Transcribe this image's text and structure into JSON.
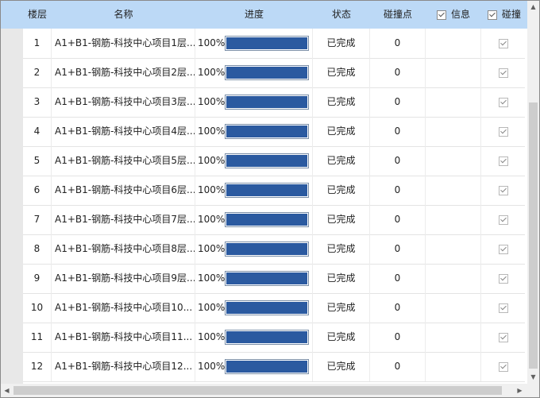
{
  "columns": {
    "floor": "楼层",
    "name": "名称",
    "progress": "进度",
    "status": "状态",
    "collision_points": "碰撞点",
    "info": "信息",
    "collision": "碰撞"
  },
  "header_checkboxes": {
    "info_checked": true,
    "collision_checked": true
  },
  "rows": [
    {
      "index": "1",
      "name": "A1+B1-钢筋-科技中心项目1层...",
      "progress_label": "100%",
      "progress": 1.0,
      "status": "已完成",
      "count": "0",
      "collision_checked": true
    },
    {
      "index": "2",
      "name": "A1+B1-钢筋-科技中心项目2层...",
      "progress_label": "100%",
      "progress": 1.0,
      "status": "已完成",
      "count": "0",
      "collision_checked": true
    },
    {
      "index": "3",
      "name": "A1+B1-钢筋-科技中心项目3层...",
      "progress_label": "100%",
      "progress": 1.0,
      "status": "已完成",
      "count": "0",
      "collision_checked": true
    },
    {
      "index": "4",
      "name": "A1+B1-钢筋-科技中心项目4层...",
      "progress_label": "100%",
      "progress": 1.0,
      "status": "已完成",
      "count": "0",
      "collision_checked": true
    },
    {
      "index": "5",
      "name": "A1+B1-钢筋-科技中心项目5层...",
      "progress_label": "100%",
      "progress": 1.0,
      "status": "已完成",
      "count": "0",
      "collision_checked": true
    },
    {
      "index": "6",
      "name": "A1+B1-钢筋-科技中心项目6层...",
      "progress_label": "100%",
      "progress": 1.0,
      "status": "已完成",
      "count": "0",
      "collision_checked": true
    },
    {
      "index": "7",
      "name": "A1+B1-钢筋-科技中心项目7层...",
      "progress_label": "100%",
      "progress": 1.0,
      "status": "已完成",
      "count": "0",
      "collision_checked": true
    },
    {
      "index": "8",
      "name": "A1+B1-钢筋-科技中心项目8层...",
      "progress_label": "100%",
      "progress": 1.0,
      "status": "已完成",
      "count": "0",
      "collision_checked": true
    },
    {
      "index": "9",
      "name": "A1+B1-钢筋-科技中心项目9层...",
      "progress_label": "100%",
      "progress": 1.0,
      "status": "已完成",
      "count": "0",
      "collision_checked": true
    },
    {
      "index": "10",
      "name": "A1+B1-钢筋-科技中心项目10...",
      "progress_label": "100%",
      "progress": 1.0,
      "status": "已完成",
      "count": "0",
      "collision_checked": true
    },
    {
      "index": "11",
      "name": "A1+B1-钢筋-科技中心项目11...",
      "progress_label": "100%",
      "progress": 1.0,
      "status": "已完成",
      "count": "0",
      "collision_checked": true
    },
    {
      "index": "12",
      "name": "A1+B1-钢筋-科技中心项目12...",
      "progress_label": "100%",
      "progress": 1.0,
      "status": "已完成",
      "count": "0",
      "collision_checked": true
    }
  ],
  "colors": {
    "header_bg": "#bcd9f6",
    "progress_fill": "#2b5aa0"
  },
  "scrollbars": {
    "vertical_up_icon": "triangle-up-icon",
    "vertical_down_icon": "triangle-down-icon",
    "horizontal_left_icon": "triangle-left-icon",
    "horizontal_right_icon": "triangle-right-icon"
  }
}
